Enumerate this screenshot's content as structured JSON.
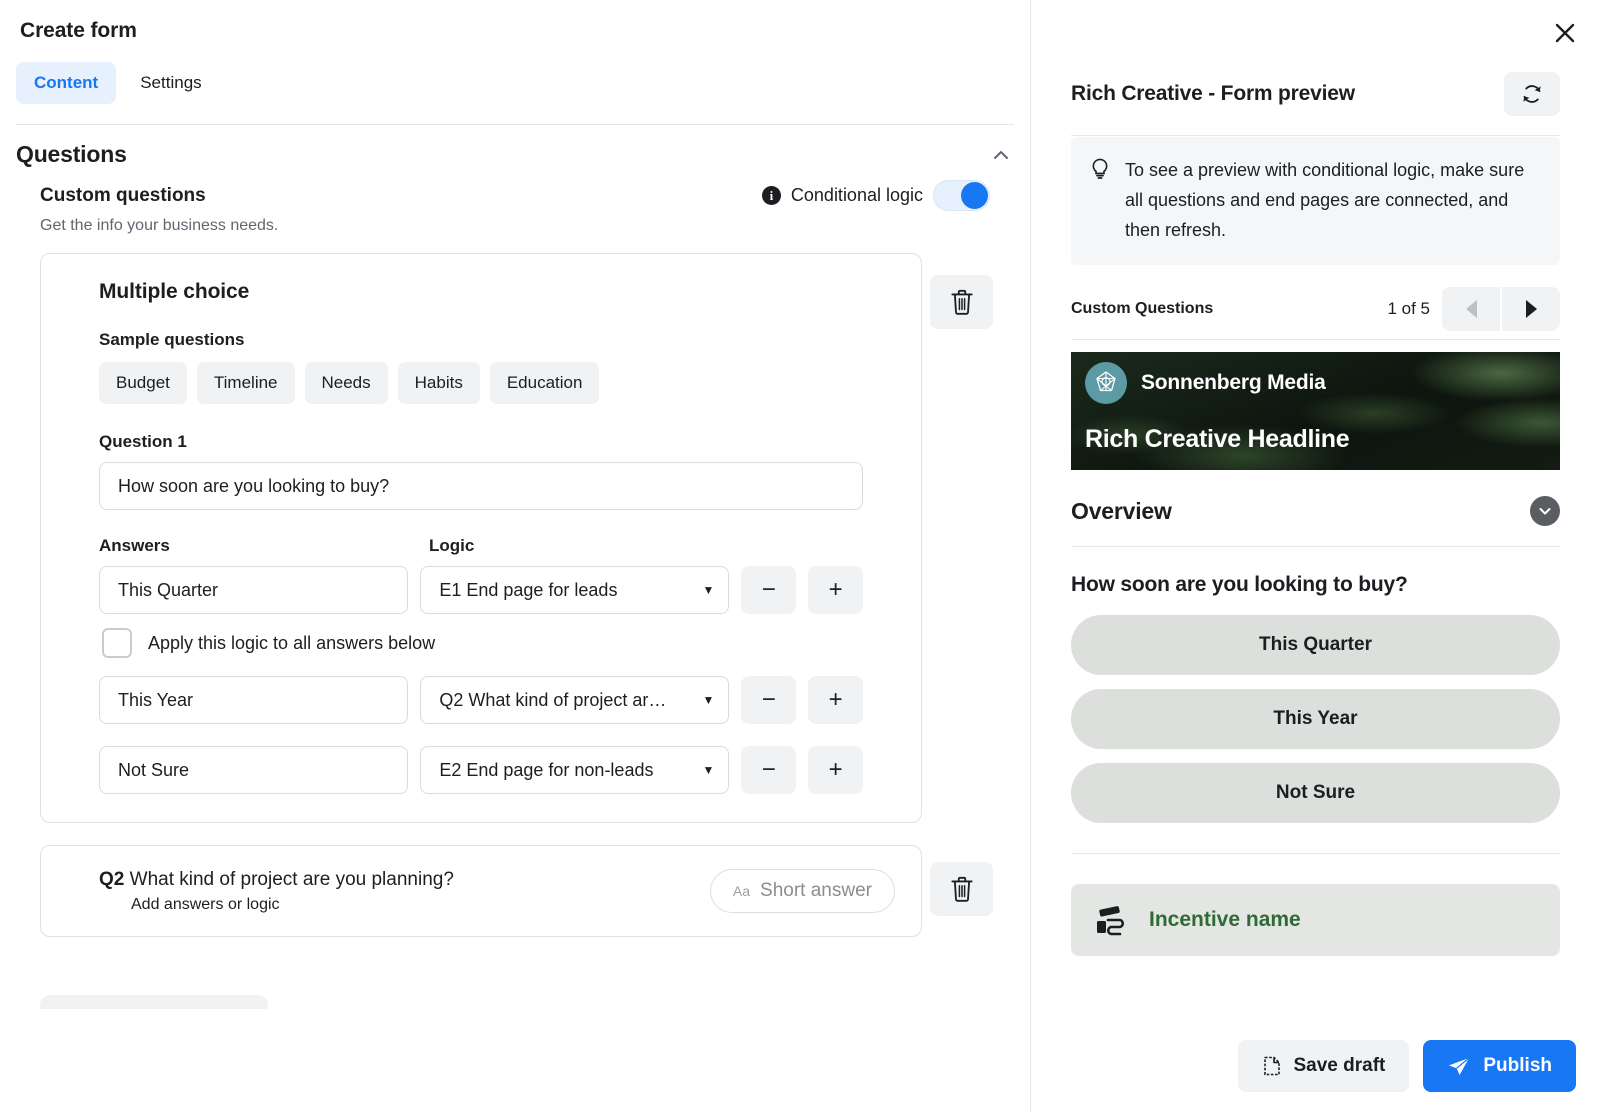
{
  "window": {
    "title": "Create form",
    "close_label": "×"
  },
  "tabs": [
    {
      "label": "Content",
      "active": true
    },
    {
      "label": "Settings",
      "active": false
    }
  ],
  "questions_section": {
    "heading": "Questions",
    "collapse_icon": "chevron-up-icon",
    "custom_questions": {
      "title": "Custom questions",
      "subtitle": "Get the info your business needs.",
      "conditional_logic": {
        "label": "Conditional logic",
        "info_icon": "info-icon",
        "enabled": true,
        "accent_color": "#1877f2"
      }
    }
  },
  "question_card": {
    "type_title": "Multiple choice",
    "sample_label": "Sample questions",
    "sample_chips": [
      "Budget",
      "Timeline",
      "Needs",
      "Habits",
      "Education"
    ],
    "question_label": "Question 1",
    "question_value": "How soon are you looking to buy?",
    "columns": {
      "answers": "Answers",
      "logic": "Logic"
    },
    "rows": [
      {
        "answer": "This Quarter",
        "logic": "E1 End page for leads",
        "minus": "−",
        "plus": "+"
      },
      {
        "answer": "This Year",
        "logic": "Q2 What kind of project ar…",
        "minus": "−",
        "plus": "+"
      },
      {
        "answer": "Not Sure",
        "logic": "E2 End page for non-leads",
        "minus": "−",
        "plus": "+"
      }
    ],
    "apply_logic": {
      "label": "Apply this logic to all answers below",
      "checked": false
    },
    "delete_icon": "trash-icon"
  },
  "question_two": {
    "prefix": "Q2",
    "title": "What kind of project are you planning?",
    "subtitle": "Add answers or logic",
    "answer_type": "Short answer",
    "answer_type_icon": "Aa",
    "delete_icon": "trash-icon"
  },
  "preview": {
    "title": "Rich Creative - Form preview",
    "refresh_icon": "refresh-icon",
    "tip": {
      "icon": "lightbulb-icon",
      "text": "To see a preview with conditional logic, make sure all questions and end pages are connected, and then refresh."
    },
    "pager": {
      "label": "Custom Questions",
      "count": "1 of 5",
      "prev_icon": "triangle-left-icon",
      "next_icon": "triangle-right-icon"
    },
    "hero": {
      "brand": "Sonnenberg Media",
      "headline": "Rich Creative Headline",
      "logo_icon": "sonnenberg-logo-icon",
      "logo_color": "#5c9aa5"
    },
    "overview": {
      "label": "Overview",
      "expand_icon": "chevron-down-icon"
    },
    "form_question": "How soon are you looking to buy?",
    "form_answers": [
      "This Quarter",
      "This Year",
      "Not Sure"
    ],
    "incentive": {
      "label": "Incentive name",
      "icon": "incentive-icon",
      "color": "#2f6b33"
    }
  },
  "actions": {
    "save_draft": {
      "label": "Save draft",
      "icon": "document-icon"
    },
    "publish": {
      "label": "Publish",
      "icon": "paper-plane-icon",
      "color": "#1877f2"
    }
  }
}
